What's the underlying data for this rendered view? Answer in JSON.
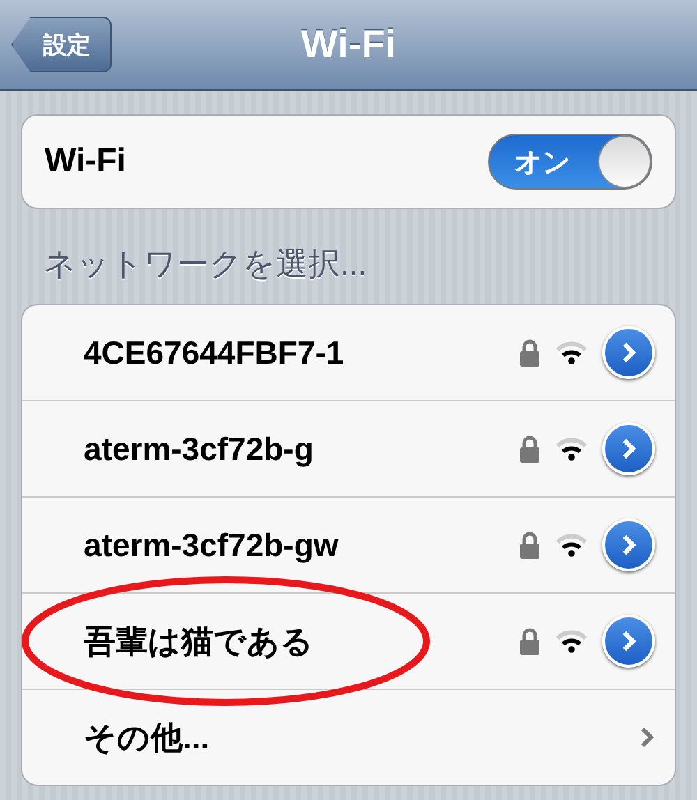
{
  "nav_bar": {
    "back_button": "設定",
    "title": "Wi-Fi"
  },
  "wifi_switch": {
    "label": "Wi-Fi",
    "toggle_text": "オン",
    "on": true
  },
  "section_header": "ネットワークを選択...",
  "networks": [
    {
      "kind": "network",
      "name": "4CE67644FBF7-1",
      "locked": true
    },
    {
      "kind": "network",
      "name": "aterm-3cf72b-g",
      "locked": true
    },
    {
      "kind": "network",
      "name": "aterm-3cf72b-gw",
      "locked": true
    },
    {
      "kind": "network",
      "name": "吾輩は猫である",
      "locked": true
    },
    {
      "kind": "other",
      "name": "その他..."
    }
  ]
}
